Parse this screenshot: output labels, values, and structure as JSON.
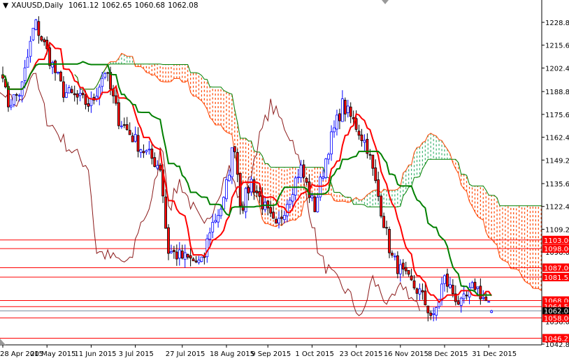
{
  "header": {
    "symbol": "XAUUSD,Daily",
    "open": "1061.12",
    "high": "1062.65",
    "low": "1060.68",
    "close": "1062.08"
  },
  "chart_data": {
    "type": "candlestick",
    "title": "XAUUSD,Daily",
    "indicator": "Ichimoku Kinko Hyo (9,26,52)",
    "ylim": [
      1042.8,
      1228.8
    ],
    "y_ticks": [
      "1228.80",
      "1215.60",
      "1202.40",
      "1188.80",
      "1175.60",
      "1162.40",
      "1149.20",
      "1135.60",
      "1122.40",
      "1109.20",
      "1096.00",
      "1056.00",
      "1042.80"
    ],
    "x_ticks": [
      {
        "label": "28 Apr 2015",
        "bar": 0
      },
      {
        "label": "20 May 2015",
        "bar": 16
      },
      {
        "label": "11 Jun 2015",
        "bar": 32
      },
      {
        "label": "3 Jul 2015",
        "bar": 48
      },
      {
        "label": "27 Jul 2015",
        "bar": 65
      },
      {
        "label": "18 Aug 2015",
        "bar": 81
      },
      {
        "label": "9 Sep 2015",
        "bar": 96
      },
      {
        "label": "1 Oct 2015",
        "bar": 112
      },
      {
        "label": "23 Oct 2015",
        "bar": 128
      },
      {
        "label": "16 Nov 2015",
        "bar": 144
      },
      {
        "label": "8 Dec 2015",
        "bar": 160
      },
      {
        "label": "31 Dec 2015",
        "bar": 176
      }
    ],
    "levels": [
      "1103.00",
      "1098.00",
      "1087.00",
      "1081.55",
      "1068.00",
      "1064.50",
      "1058.00",
      "1046.25"
    ],
    "current_price": "1062.08",
    "close_anchors": [
      [
        0,
        1201
      ],
      [
        1.5,
        1181
      ],
      [
        6.6,
        1189
      ],
      [
        11.6,
        1229
      ],
      [
        16.7,
        1209
      ],
      [
        21.8,
        1189
      ],
      [
        26.8,
        1185
      ],
      [
        31.9,
        1181
      ],
      [
        37,
        1201
      ],
      [
        42,
        1173
      ],
      [
        49.6,
        1157
      ],
      [
        57.2,
        1145
      ],
      [
        59.7,
        1097
      ],
      [
        64.8,
        1093
      ],
      [
        72.4,
        1089
      ],
      [
        74.9,
        1109
      ],
      [
        80,
        1125
      ],
      [
        83.8,
        1161
      ],
      [
        86.3,
        1121
      ],
      [
        90,
        1137
      ],
      [
        95,
        1121
      ],
      [
        99,
        1109
      ],
      [
        102.8,
        1125
      ],
      [
        107.8,
        1145
      ],
      [
        112.9,
        1121
      ],
      [
        118,
        1157
      ],
      [
        123,
        1181
      ],
      [
        128,
        1169
      ],
      [
        132,
        1157
      ],
      [
        137,
        1121
      ],
      [
        140.8,
        1093
      ],
      [
        145.8,
        1081
      ],
      [
        150.9,
        1073
      ],
      [
        156,
        1057
      ],
      [
        159.7,
        1081
      ],
      [
        166,
        1065
      ],
      [
        171,
        1077
      ],
      [
        176,
        1065
      ],
      [
        177,
        1062.08
      ]
    ],
    "colors": {
      "bull": "#0000FF",
      "bear_fill": "#FF0000",
      "tenkan": "#FF0000",
      "kijun": "#008000",
      "chikou": "#8B1A1A",
      "cloud_bear": "#FF4500",
      "cloud_bull": "#3CB371",
      "level": "#FF0000"
    }
  }
}
